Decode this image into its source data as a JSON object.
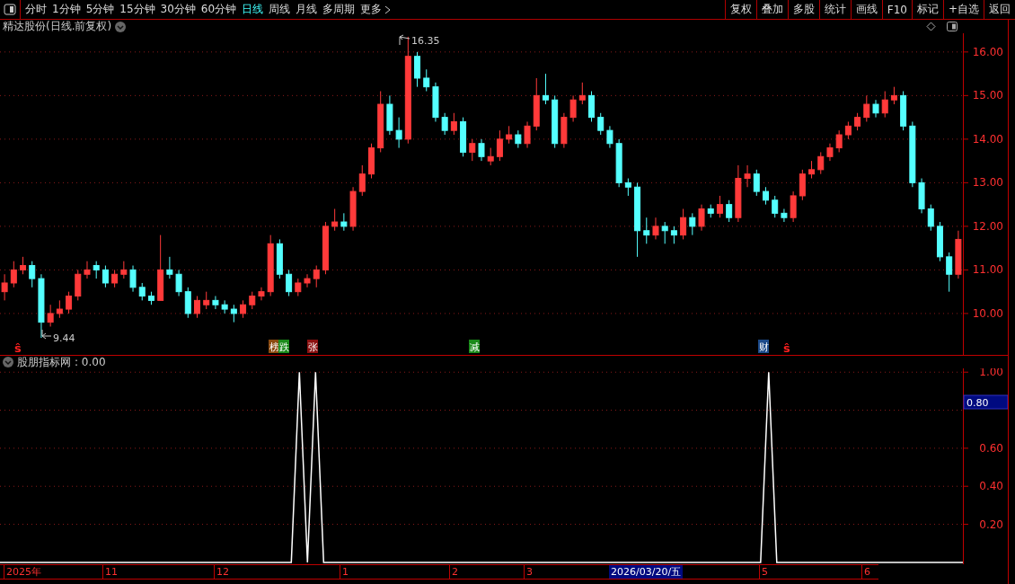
{
  "toolbar": {
    "tabs": [
      {
        "label": "分时",
        "selected": false
      },
      {
        "label": "1分钟",
        "selected": false
      },
      {
        "label": "5分钟",
        "selected": false
      },
      {
        "label": "15分钟",
        "selected": false
      },
      {
        "label": "30分钟",
        "selected": false
      },
      {
        "label": "60分钟",
        "selected": false
      },
      {
        "label": "日线",
        "selected": true
      },
      {
        "label": "周线",
        "selected": false
      },
      {
        "label": "月线",
        "selected": false
      },
      {
        "label": "多周期",
        "selected": false
      },
      {
        "label": "更多",
        "selected": false
      }
    ],
    "buttons": [
      "复权",
      "叠加",
      "多股",
      "统计",
      "画线",
      "F10",
      "标记",
      "+自选",
      "返回"
    ]
  },
  "price_chart": {
    "title": "精达股份(日线.前复权)",
    "high_label": "16.35",
    "low_label": "9.44",
    "chart_data": {
      "type": "candlestick",
      "ylim": [
        9.05,
        16.43
      ],
      "grid": true,
      "yticks": [
        {
          "value": 16,
          "label": "16.00"
        },
        {
          "value": 15,
          "label": "15.00"
        },
        {
          "value": 14,
          "label": "14.00"
        },
        {
          "value": 13,
          "label": "13.00"
        },
        {
          "value": 12,
          "label": "12.00"
        },
        {
          "value": 11,
          "label": "11.00"
        },
        {
          "value": 10,
          "label": "10.00"
        }
      ],
      "ohlc": [
        [
          10.5,
          10.9,
          10.3,
          10.7
        ],
        [
          10.7,
          11.2,
          10.6,
          11.0
        ],
        [
          11.0,
          11.3,
          10.9,
          11.1
        ],
        [
          11.1,
          11.2,
          10.6,
          10.8
        ],
        [
          10.8,
          10.9,
          9.44,
          9.8
        ],
        [
          9.8,
          10.2,
          9.7,
          10.0
        ],
        [
          10.0,
          10.3,
          9.9,
          10.1
        ],
        [
          10.1,
          10.5,
          10.0,
          10.4
        ],
        [
          10.4,
          11.0,
          10.3,
          10.9
        ],
        [
          10.9,
          11.2,
          10.8,
          11.0
        ],
        [
          11.1,
          11.2,
          10.8,
          11.0
        ],
        [
          11.0,
          11.1,
          10.6,
          10.7
        ],
        [
          10.7,
          11.0,
          10.6,
          10.9
        ],
        [
          10.9,
          11.2,
          10.8,
          11.0
        ],
        [
          11.0,
          11.1,
          10.5,
          10.6
        ],
        [
          10.6,
          10.7,
          10.3,
          10.4
        ],
        [
          10.4,
          10.5,
          10.2,
          10.3
        ],
        [
          10.3,
          11.8,
          10.3,
          11.0
        ],
        [
          11.0,
          11.3,
          10.8,
          10.9
        ],
        [
          10.9,
          11.0,
          10.4,
          10.5
        ],
        [
          10.5,
          10.6,
          9.9,
          10.0
        ],
        [
          10.0,
          10.4,
          9.9,
          10.3
        ],
        [
          10.2,
          10.5,
          10.1,
          10.3
        ],
        [
          10.3,
          10.4,
          10.1,
          10.2
        ],
        [
          10.2,
          10.3,
          10.0,
          10.1
        ],
        [
          10.1,
          10.2,
          9.8,
          10.0
        ],
        [
          10.0,
          10.3,
          9.9,
          10.2
        ],
        [
          10.2,
          10.5,
          10.1,
          10.4
        ],
        [
          10.4,
          10.6,
          10.3,
          10.5
        ],
        [
          10.5,
          11.8,
          10.4,
          11.6
        ],
        [
          11.6,
          11.7,
          10.8,
          10.9
        ],
        [
          10.9,
          11.0,
          10.4,
          10.5
        ],
        [
          10.5,
          10.8,
          10.4,
          10.7
        ],
        [
          10.7,
          10.9,
          10.6,
          10.8
        ],
        [
          10.8,
          11.1,
          10.6,
          11.0
        ],
        [
          11.0,
          12.1,
          10.9,
          12.0
        ],
        [
          12.0,
          12.4,
          11.9,
          12.1
        ],
        [
          12.1,
          12.3,
          11.9,
          12.0
        ],
        [
          12.0,
          12.9,
          11.9,
          12.8
        ],
        [
          12.8,
          13.4,
          12.7,
          13.2
        ],
        [
          13.2,
          13.9,
          13.1,
          13.8
        ],
        [
          13.8,
          15.1,
          13.7,
          14.8
        ],
        [
          14.8,
          15.0,
          14.1,
          14.2
        ],
        [
          14.2,
          14.5,
          13.8,
          14.0
        ],
        [
          14.0,
          16.35,
          13.9,
          15.9
        ],
        [
          15.9,
          16.0,
          15.2,
          15.4
        ],
        [
          15.4,
          15.6,
          15.1,
          15.2
        ],
        [
          15.2,
          15.3,
          14.4,
          14.5
        ],
        [
          14.5,
          14.6,
          14.1,
          14.2
        ],
        [
          14.2,
          14.6,
          14.1,
          14.4
        ],
        [
          14.4,
          14.5,
          13.6,
          13.7
        ],
        [
          13.7,
          14.0,
          13.5,
          13.9
        ],
        [
          13.9,
          14.0,
          13.5,
          13.6
        ],
        [
          13.5,
          13.8,
          13.4,
          13.6
        ],
        [
          13.6,
          14.2,
          13.5,
          14.0
        ],
        [
          14.0,
          14.3,
          13.9,
          14.1
        ],
        [
          14.1,
          14.2,
          13.8,
          13.9
        ],
        [
          13.9,
          14.4,
          13.8,
          14.3
        ],
        [
          14.3,
          15.4,
          14.2,
          15.0
        ],
        [
          15.0,
          15.5,
          14.8,
          14.9
        ],
        [
          14.9,
          15.0,
          13.8,
          13.9
        ],
        [
          13.9,
          14.6,
          13.8,
          14.5
        ],
        [
          14.5,
          15.0,
          14.4,
          14.9
        ],
        [
          14.9,
          15.3,
          14.8,
          15.0
        ],
        [
          15.0,
          15.1,
          14.4,
          14.5
        ],
        [
          14.5,
          14.6,
          14.1,
          14.2
        ],
        [
          14.2,
          14.3,
          13.8,
          13.9
        ],
        [
          13.9,
          14.0,
          12.9,
          13.0
        ],
        [
          13.0,
          13.1,
          12.7,
          12.9
        ],
        [
          12.9,
          13.0,
          11.3,
          11.9
        ],
        [
          11.9,
          12.2,
          11.6,
          11.8
        ],
        [
          11.8,
          12.2,
          11.7,
          12.0
        ],
        [
          12.0,
          12.1,
          11.6,
          11.9
        ],
        [
          11.9,
          12.0,
          11.6,
          11.8
        ],
        [
          11.8,
          12.4,
          11.7,
          12.2
        ],
        [
          12.2,
          12.3,
          11.8,
          12.0
        ],
        [
          12.0,
          12.5,
          11.9,
          12.4
        ],
        [
          12.4,
          12.5,
          12.2,
          12.3
        ],
        [
          12.3,
          12.7,
          12.2,
          12.5
        ],
        [
          12.5,
          12.6,
          12.1,
          12.2
        ],
        [
          12.2,
          13.4,
          12.1,
          13.1
        ],
        [
          13.1,
          13.4,
          12.9,
          13.2
        ],
        [
          13.2,
          13.3,
          12.7,
          12.8
        ],
        [
          12.8,
          12.9,
          12.5,
          12.6
        ],
        [
          12.6,
          12.7,
          12.2,
          12.3
        ],
        [
          12.3,
          12.4,
          12.1,
          12.2
        ],
        [
          12.2,
          12.8,
          12.1,
          12.7
        ],
        [
          12.7,
          13.3,
          12.6,
          13.2
        ],
        [
          13.2,
          13.5,
          13.1,
          13.3
        ],
        [
          13.3,
          13.7,
          13.2,
          13.6
        ],
        [
          13.6,
          13.9,
          13.5,
          13.8
        ],
        [
          13.8,
          14.2,
          13.7,
          14.1
        ],
        [
          14.1,
          14.4,
          14.0,
          14.3
        ],
        [
          14.3,
          14.6,
          14.2,
          14.5
        ],
        [
          14.5,
          15.0,
          14.4,
          14.8
        ],
        [
          14.8,
          14.9,
          14.5,
          14.6
        ],
        [
          14.6,
          15.1,
          14.5,
          14.9
        ],
        [
          14.9,
          15.2,
          14.8,
          15.0
        ],
        [
          15.0,
          15.1,
          14.2,
          14.3
        ],
        [
          14.3,
          14.4,
          12.9,
          13.0
        ],
        [
          13.0,
          13.1,
          12.3,
          12.4
        ],
        [
          12.4,
          12.5,
          11.9,
          12.0
        ],
        [
          12.0,
          12.1,
          11.2,
          11.3
        ],
        [
          11.3,
          11.4,
          10.5,
          10.9
        ],
        [
          10.9,
          11.9,
          10.8,
          11.7
        ]
      ]
    },
    "signal_tags": [
      {
        "label": "ŝ",
        "kind": "signal",
        "color": "#ff2020"
      },
      {
        "label": "榜",
        "kind": "tag",
        "color": "#8b4a10"
      },
      {
        "label": "跌",
        "kind": "tag",
        "color": "#1a8a1a"
      },
      {
        "label": "张",
        "kind": "tag",
        "color": "#8b1010"
      },
      {
        "label": "减",
        "kind": "tag",
        "color": "#1a8a1a"
      },
      {
        "label": "财",
        "kind": "tag",
        "color": "#1c4a8a"
      },
      {
        "label": "ŝ",
        "kind": "signal",
        "color": "#ff2020"
      }
    ]
  },
  "indicator": {
    "value": ": 0.00",
    "cursor_value": "0.80",
    "chart_data": {
      "type": "line",
      "ylim": [
        -0.01,
        1.02
      ],
      "grid": true,
      "yticks": [
        {
          "value": 0.2,
          "label": "0.20"
        },
        {
          "value": 0.4,
          "label": "0.40"
        },
        {
          "value": 0.6,
          "label": "0.60"
        },
        {
          "value": 1.0,
          "label": "1.00"
        }
      ],
      "series": [
        {
          "name": "股朋指标网",
          "color": "#ffffff",
          "values": [
            0,
            0,
            0,
            0,
            0,
            0,
            0,
            0,
            0,
            0,
            0,
            0,
            0,
            0,
            0,
            0,
            0,
            0,
            0,
            0,
            0,
            0,
            0,
            0,
            0,
            0,
            0,
            0,
            0,
            0,
            0,
            0,
            0,
            0,
            0,
            0,
            0,
            1,
            0,
            1,
            0,
            0,
            0,
            0,
            0,
            0,
            0,
            0,
            0,
            0,
            0,
            0,
            0,
            0,
            0,
            0,
            0,
            0,
            0,
            0,
            0,
            0,
            0,
            0,
            0,
            0,
            0,
            0,
            0,
            0,
            0,
            0,
            0,
            0,
            0,
            0,
            0,
            0,
            0,
            0,
            0,
            0,
            0,
            0,
            0,
            0,
            0,
            0,
            0,
            0,
            0,
            0,
            0,
            0,
            0,
            1,
            0,
            0,
            0,
            0,
            0,
            0,
            0,
            0,
            0,
            0,
            0,
            0,
            0,
            0,
            0,
            0,
            0,
            0,
            0,
            0,
            0,
            0,
            0,
            0
          ]
        }
      ]
    }
  },
  "date_axis": {
    "labels": [
      "2025年",
      "11",
      "12",
      "1",
      "2",
      "3",
      "5",
      "6"
    ],
    "cursor_date": "2026/03/20/五"
  }
}
